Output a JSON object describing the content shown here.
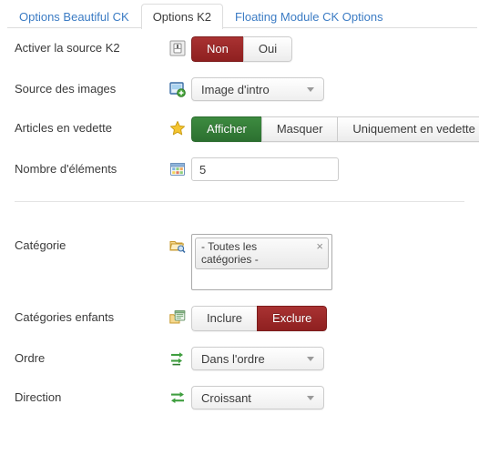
{
  "tabs": [
    {
      "label": "Options Beautiful CK",
      "active": false
    },
    {
      "label": "Options K2",
      "active": true
    },
    {
      "label": "Floating Module CK Options",
      "active": false
    }
  ],
  "colors": {
    "active_red": "#8f2020",
    "active_green": "#2c7030",
    "tab_link": "#3c7cc4",
    "text": "#3a3a3a",
    "border": "#cccccc"
  },
  "form": {
    "enable_k2": {
      "label": "Activer la source K2",
      "icon": "toggle-switch-icon",
      "options": [
        "Non",
        "Oui"
      ],
      "selected": "Non"
    },
    "image_source": {
      "label": "Source des images",
      "icon": "image-add-icon",
      "value": "Image d'intro"
    },
    "featured_articles": {
      "label": "Articles en vedette",
      "icon": "star-icon",
      "options": [
        "Afficher",
        "Masquer",
        "Uniquement en vedette"
      ],
      "selected": "Afficher"
    },
    "item_count": {
      "label": "Nombre d'éléments",
      "icon": "grid-calendar-icon",
      "value": "5"
    },
    "category": {
      "label": "Catégorie",
      "icon": "folder-search-icon",
      "chip": "- Toutes les catégories -",
      "remove_label": "×"
    },
    "child_categories": {
      "label": "Catégories enfants",
      "icon": "folders-icon",
      "options": [
        "Inclure",
        "Exclure"
      ],
      "selected": "Exclure"
    },
    "order": {
      "label": "Ordre",
      "icon": "sort-arrows-icon",
      "value": "Dans l'ordre"
    },
    "direction": {
      "label": "Direction",
      "icon": "swap-arrows-icon",
      "value": "Croissant"
    }
  }
}
